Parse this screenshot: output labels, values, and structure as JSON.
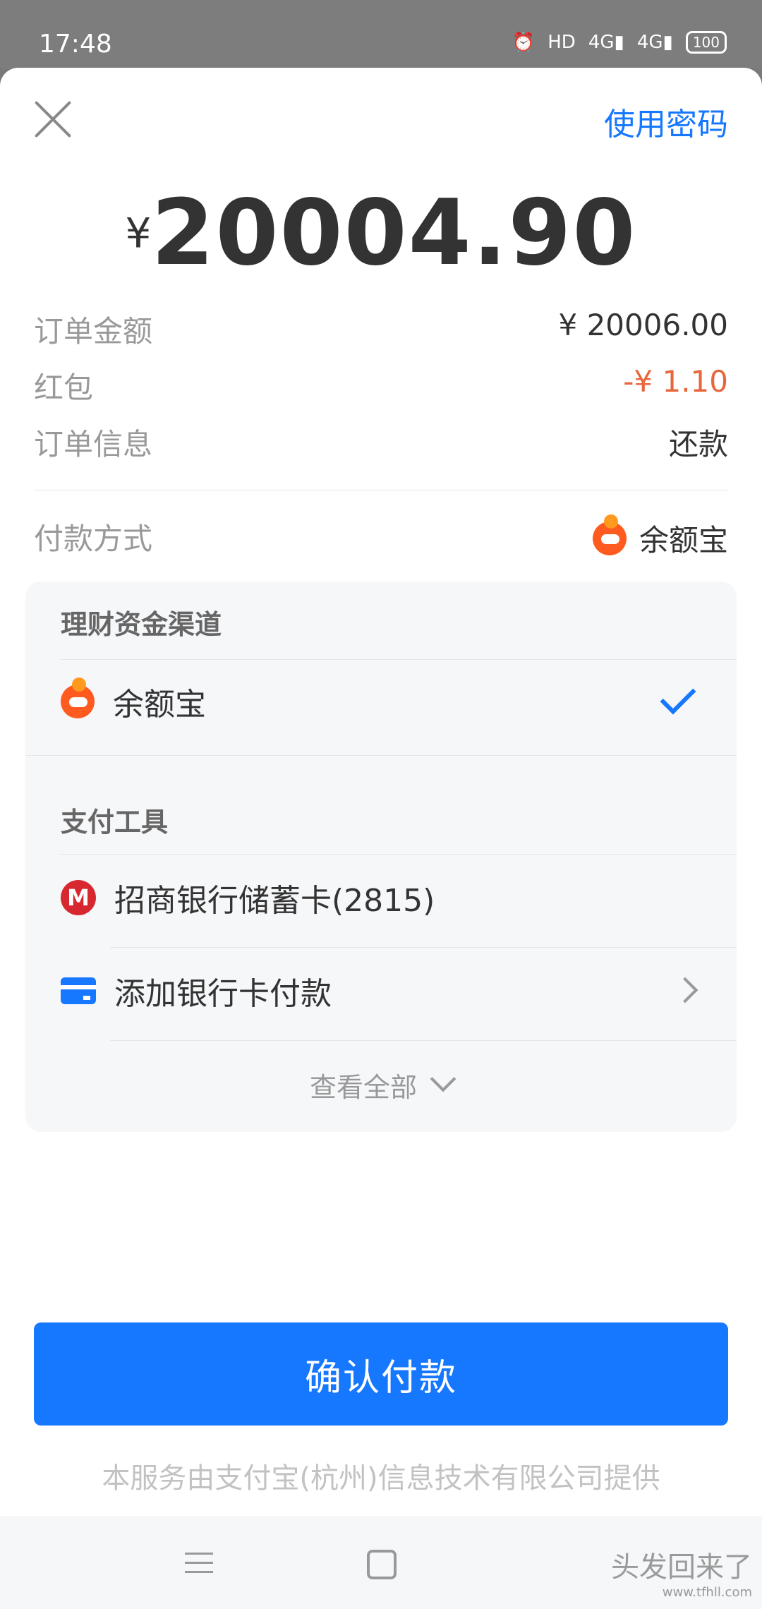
{
  "status_bar": {
    "time": "17:48",
    "icons": [
      "alarm-icon",
      "hd-icon",
      "4g-signal-icon",
      "4g-signal-icon"
    ],
    "battery": "100"
  },
  "header": {
    "use_password": "使用密码"
  },
  "amount": {
    "currency": "¥",
    "value": "20004.90"
  },
  "details": [
    {
      "label": "订单金额",
      "value": "¥ 20006.00"
    },
    {
      "label": "红包",
      "value": "-¥ 1.10",
      "color": "#e8663c"
    },
    {
      "label": "订单信息",
      "value": "还款"
    }
  ],
  "payment": {
    "label": "付款方式",
    "selected": "余额宝"
  },
  "panel": {
    "section1_title": "理财资金渠道",
    "section1_items": [
      {
        "label": "余额宝",
        "selected": true
      }
    ],
    "section2_title": "支付工具",
    "section2_items": [
      {
        "label": "招商银行储蓄卡(2815)",
        "icon": "cmb-bank-icon"
      },
      {
        "label": "添加银行卡付款",
        "icon": "bank-card-icon"
      }
    ],
    "view_all": "查看全部"
  },
  "confirm_label": "确认付款",
  "provider": "本服务由支付宝(杭州)信息技术有限公司提供",
  "watermark": {
    "line1": "头发回来了",
    "line2": "www.tfhll.com"
  },
  "colors": {
    "accent": "#1677ff",
    "discount": "#e8663c",
    "yeb_orange": "#ff5a1f"
  }
}
